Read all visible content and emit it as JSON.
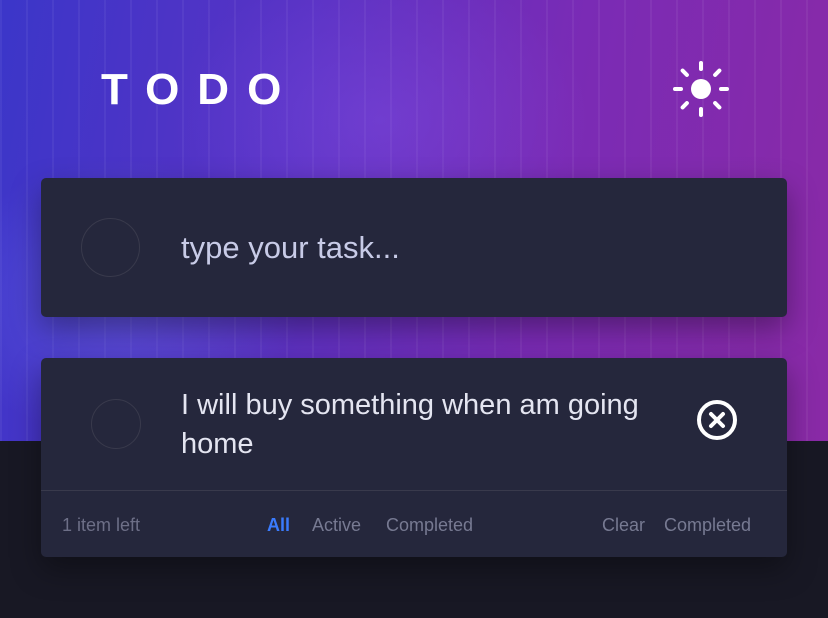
{
  "header": {
    "title": "TODO",
    "theme_toggle_icon": "sun-icon"
  },
  "new_task": {
    "placeholder": "type your task...",
    "value": ""
  },
  "todos": [
    {
      "text": "I will buy something when am going home",
      "completed": false,
      "delete_icon": "close-circle-icon"
    }
  ],
  "footer": {
    "items_left": "1 item left",
    "filters": [
      {
        "label": "All",
        "active": true
      },
      {
        "label": "Active",
        "active": false
      },
      {
        "label": "Completed",
        "active": false
      }
    ],
    "clear_label": "Clear Completed"
  },
  "colors": {
    "accent": "#3a7bfd",
    "card_bg": "#25273c",
    "page_bg": "#181824",
    "hero_gradient_start": "#3b36c9",
    "hero_gradient_end": "#8a2aa6"
  }
}
